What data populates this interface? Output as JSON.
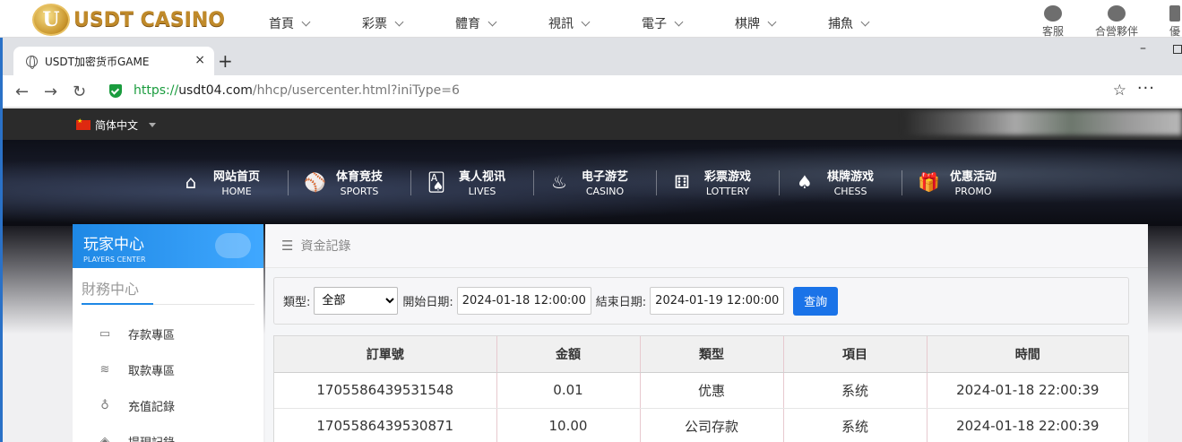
{
  "site": {
    "logo_letter": "U",
    "logo_text": "USDT CASINO",
    "nav": [
      "首頁",
      "彩票",
      "體育",
      "視訊",
      "電子",
      "棋牌",
      "捕魚"
    ],
    "right_links": [
      "客服",
      "合營夥伴",
      "優"
    ]
  },
  "browser": {
    "tab_title": "USDT加密货币GAME",
    "tab_close": "×",
    "new_tab": "+",
    "url_scheme": "https://",
    "url_host": "usdt04.com",
    "url_path": "/hhcp/usercenter.html?iniType=6",
    "back": "←",
    "forward": "→",
    "reload": "↻",
    "star": "☆",
    "more": "···",
    "minimize": "–"
  },
  "page": {
    "language": "简体中文",
    "main_nav": [
      {
        "cn": "网站首页",
        "en": "HOME",
        "icon": "home-icon",
        "glyph": "⌂"
      },
      {
        "cn": "体育竞技",
        "en": "SPORTS",
        "icon": "ball-icon",
        "glyph": "⚾"
      },
      {
        "cn": "真人视讯",
        "en": "LIVES",
        "icon": "cards-icon",
        "glyph": "🂡"
      },
      {
        "cn": "电子游艺",
        "en": "CASINO",
        "icon": "slot-icon",
        "glyph": "♨"
      },
      {
        "cn": "彩票游戏",
        "en": "LOTTERY",
        "icon": "dice-icon",
        "glyph": "⚅"
      },
      {
        "cn": "棋牌游戏",
        "en": "CHESS",
        "icon": "spade-icon",
        "glyph": "♠"
      },
      {
        "cn": "优惠活动",
        "en": "PROMO",
        "icon": "gift-icon",
        "glyph": "🎁"
      }
    ],
    "sidebar": {
      "title": "玩家中心",
      "subtitle": "PLAYERS CENTER",
      "section": "財務中心",
      "items": [
        {
          "label": "存款專區",
          "glyph": "▭"
        },
        {
          "label": "取款專區",
          "glyph": "≋"
        },
        {
          "label": "充值記錄",
          "glyph": "♁"
        },
        {
          "label": "提現記錄",
          "glyph": "◈"
        }
      ]
    },
    "breadcrumb": "資金記錄",
    "filter": {
      "type_label": "類型:",
      "type_value": "全部",
      "start_label": "開始日期:",
      "start_value": "2024-01-18 12:00:00",
      "end_label": "結束日期:",
      "end_value": "2024-01-19 12:00:00",
      "query_button": "查詢"
    },
    "table": {
      "headers": [
        "訂單號",
        "金額",
        "類型",
        "項目",
        "時間"
      ],
      "rows": [
        [
          "1705586439531548",
          "0.01",
          "优惠",
          "系统",
          "2024-01-18 22:00:39"
        ],
        [
          "1705586439530871",
          "10.00",
          "公司存款",
          "系统",
          "2024-01-18 22:00:39"
        ]
      ]
    }
  }
}
